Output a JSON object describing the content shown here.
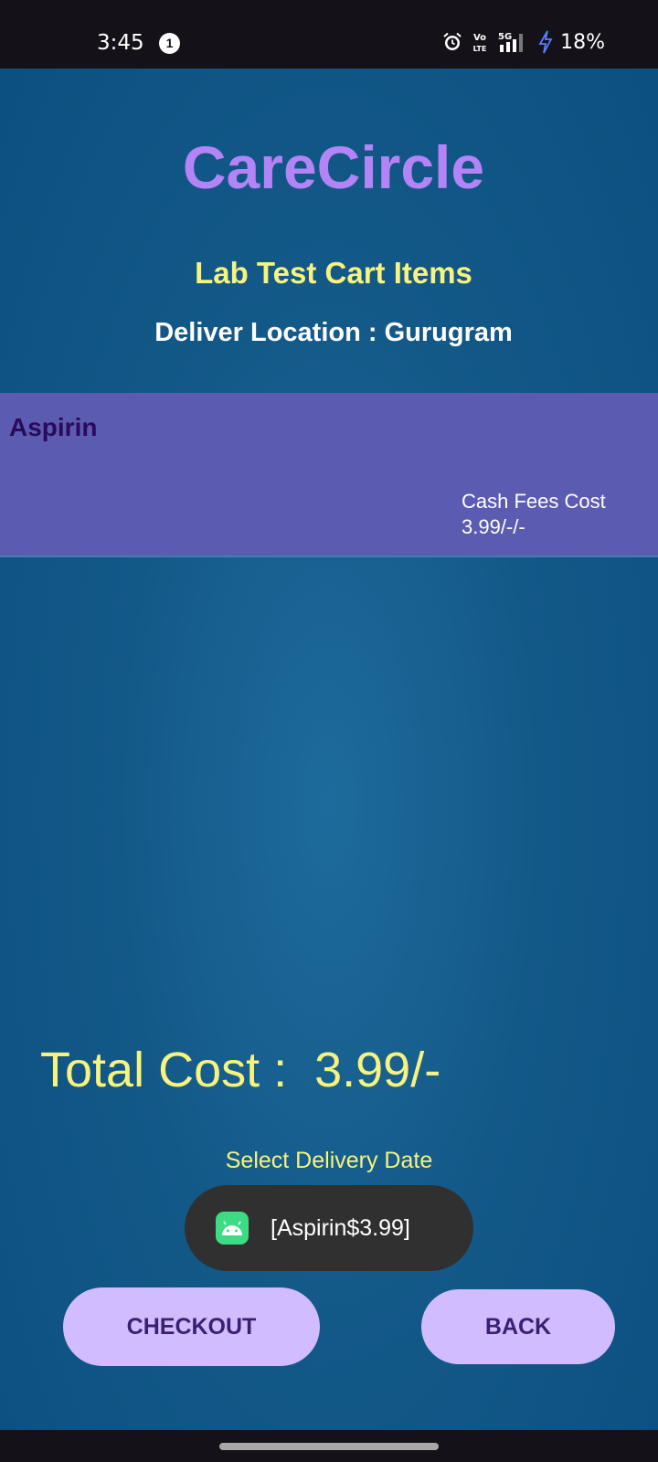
{
  "status_bar": {
    "time": "3:45",
    "notification_count": "1",
    "network_label": "5G",
    "volte_label": "Vo LTE",
    "battery": "18%"
  },
  "header": {
    "app_title": "CareCircle",
    "page_heading": "Lab Test Cart Items",
    "location": "Deliver Location : Gurugram"
  },
  "cart": {
    "items": [
      {
        "name": "Aspirin",
        "cost_label": "Cash Fees Cost",
        "cost_value": "3.99/-/-"
      }
    ]
  },
  "summary": {
    "total_cost": "Total Cost :  3.99/-",
    "delivery_date_label": "Select Delivery Date"
  },
  "toast": {
    "message": "[Aspirin$3.99]",
    "icon": "android-icon"
  },
  "buttons": {
    "checkout": "CHECKOUT",
    "back": "BACK"
  },
  "colors": {
    "background": "#135988",
    "title": "#b284f5",
    "accent_yellow": "#f7f37d",
    "cart_item": "#5b5bb2",
    "button": "#d0bcfe",
    "button_text": "#3b1f72"
  }
}
